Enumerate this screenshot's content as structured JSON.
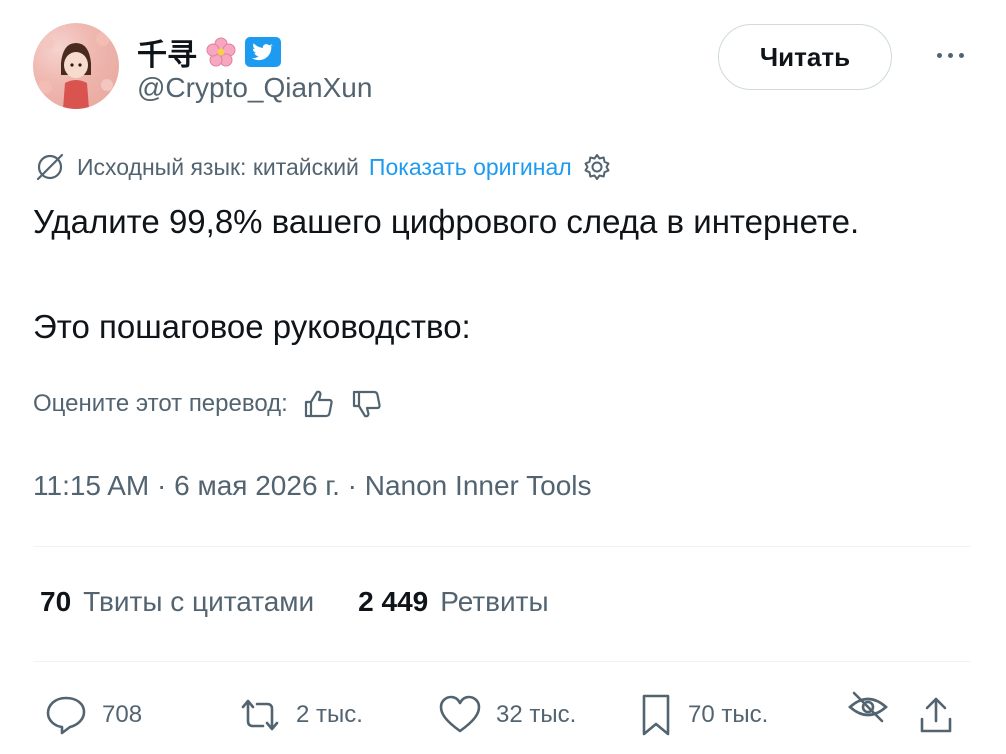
{
  "author": {
    "display_name": "千寻",
    "handle": "@Crypto_QianXun",
    "badge_emoji": "🌸",
    "verified_icon": "bird-icon"
  },
  "follow_button": {
    "label": "Читать"
  },
  "translation": {
    "source_label": "Исходный язык: китайский",
    "show_original": "Показать оригинал"
  },
  "tweet": {
    "line1": "Удалите 99,8% вашего цифрового следа в интернете.",
    "line2": "Это пошаговое руководство:"
  },
  "rate_translation": {
    "label": "Оцените этот перевод:"
  },
  "meta": {
    "text": "11:15 AM · 6 мая 2026 г. · Nanon Inner Tools"
  },
  "stats": {
    "quotes_count": "70",
    "quotes_label": "Твиты с цитатами",
    "retweets_count": "2 449",
    "retweets_label": "Ретвиты"
  },
  "actions": {
    "replies": "708",
    "retweets": "2 тыс.",
    "likes": "32 тыс.",
    "bookmarks": "70 тыс."
  },
  "colors": {
    "text": "#0f1419",
    "secondary": "#536471",
    "link": "#1d9bf0",
    "divider": "#eff3f4"
  }
}
